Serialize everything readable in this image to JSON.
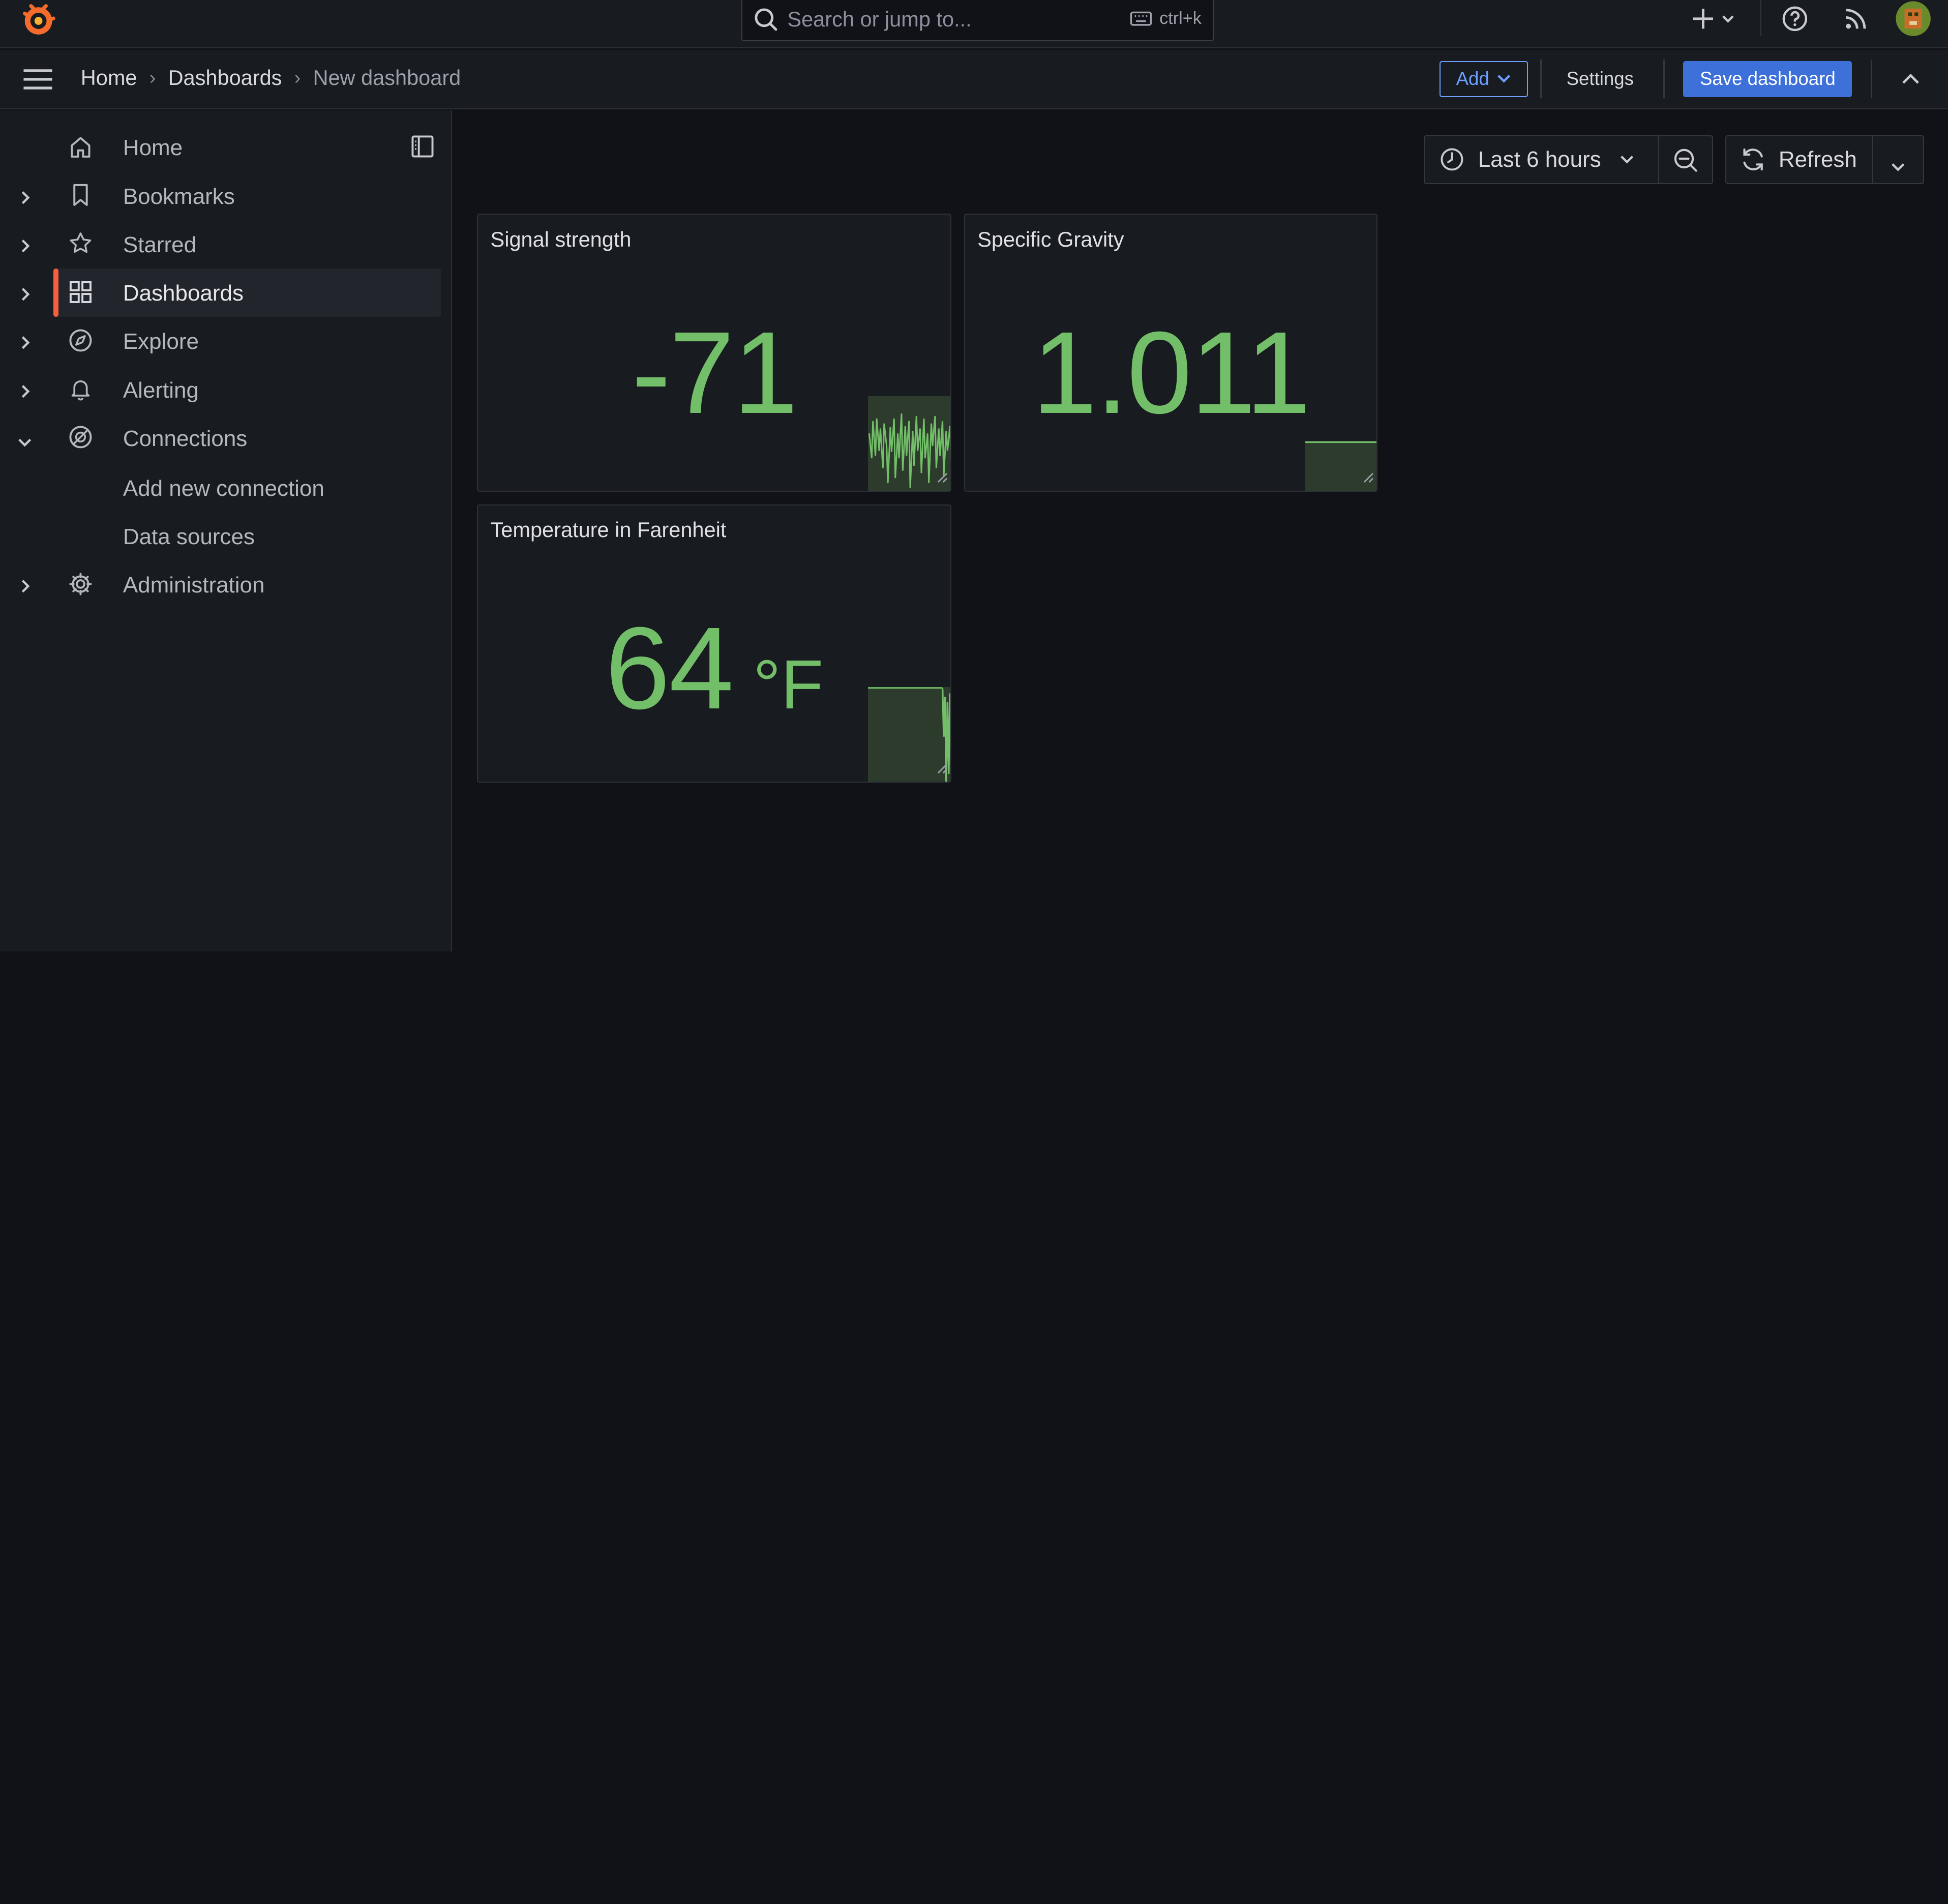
{
  "search": {
    "placeholder": "Search or jump to...",
    "shortcut": "ctrl+k"
  },
  "breadcrumb": [
    "Home",
    "Dashboards",
    "New dashboard"
  ],
  "toolbar": {
    "add_label": "Add",
    "settings_label": "Settings",
    "save_label": "Save dashboard"
  },
  "sidebar": {
    "items": [
      {
        "label": "Home",
        "icon": "home-icon"
      },
      {
        "label": "Bookmarks",
        "icon": "bookmark-icon"
      },
      {
        "label": "Starred",
        "icon": "star-icon"
      },
      {
        "label": "Dashboards",
        "icon": "apps-icon",
        "active": true
      },
      {
        "label": "Explore",
        "icon": "compass-icon"
      },
      {
        "label": "Alerting",
        "icon": "bell-icon"
      },
      {
        "label": "Connections",
        "icon": "link-icon",
        "expanded": true
      },
      {
        "label": "Add new connection"
      },
      {
        "label": "Data sources"
      },
      {
        "label": "Administration",
        "icon": "cog-icon"
      }
    ]
  },
  "time_picker": {
    "label": "Last 6 hours"
  },
  "refresh": {
    "label": "Refresh"
  },
  "panels": [
    {
      "title": "Signal strength",
      "value": "-71",
      "unit": ""
    },
    {
      "title": "Specific Gravity",
      "value": "1.011",
      "unit": ""
    },
    {
      "title": "Temperature in Farenheit",
      "value": "64",
      "unit": "°F"
    }
  ],
  "colors": {
    "accent": "#3d71d9",
    "value_green": "#73bf69",
    "active_bar": "#f55f3e"
  }
}
